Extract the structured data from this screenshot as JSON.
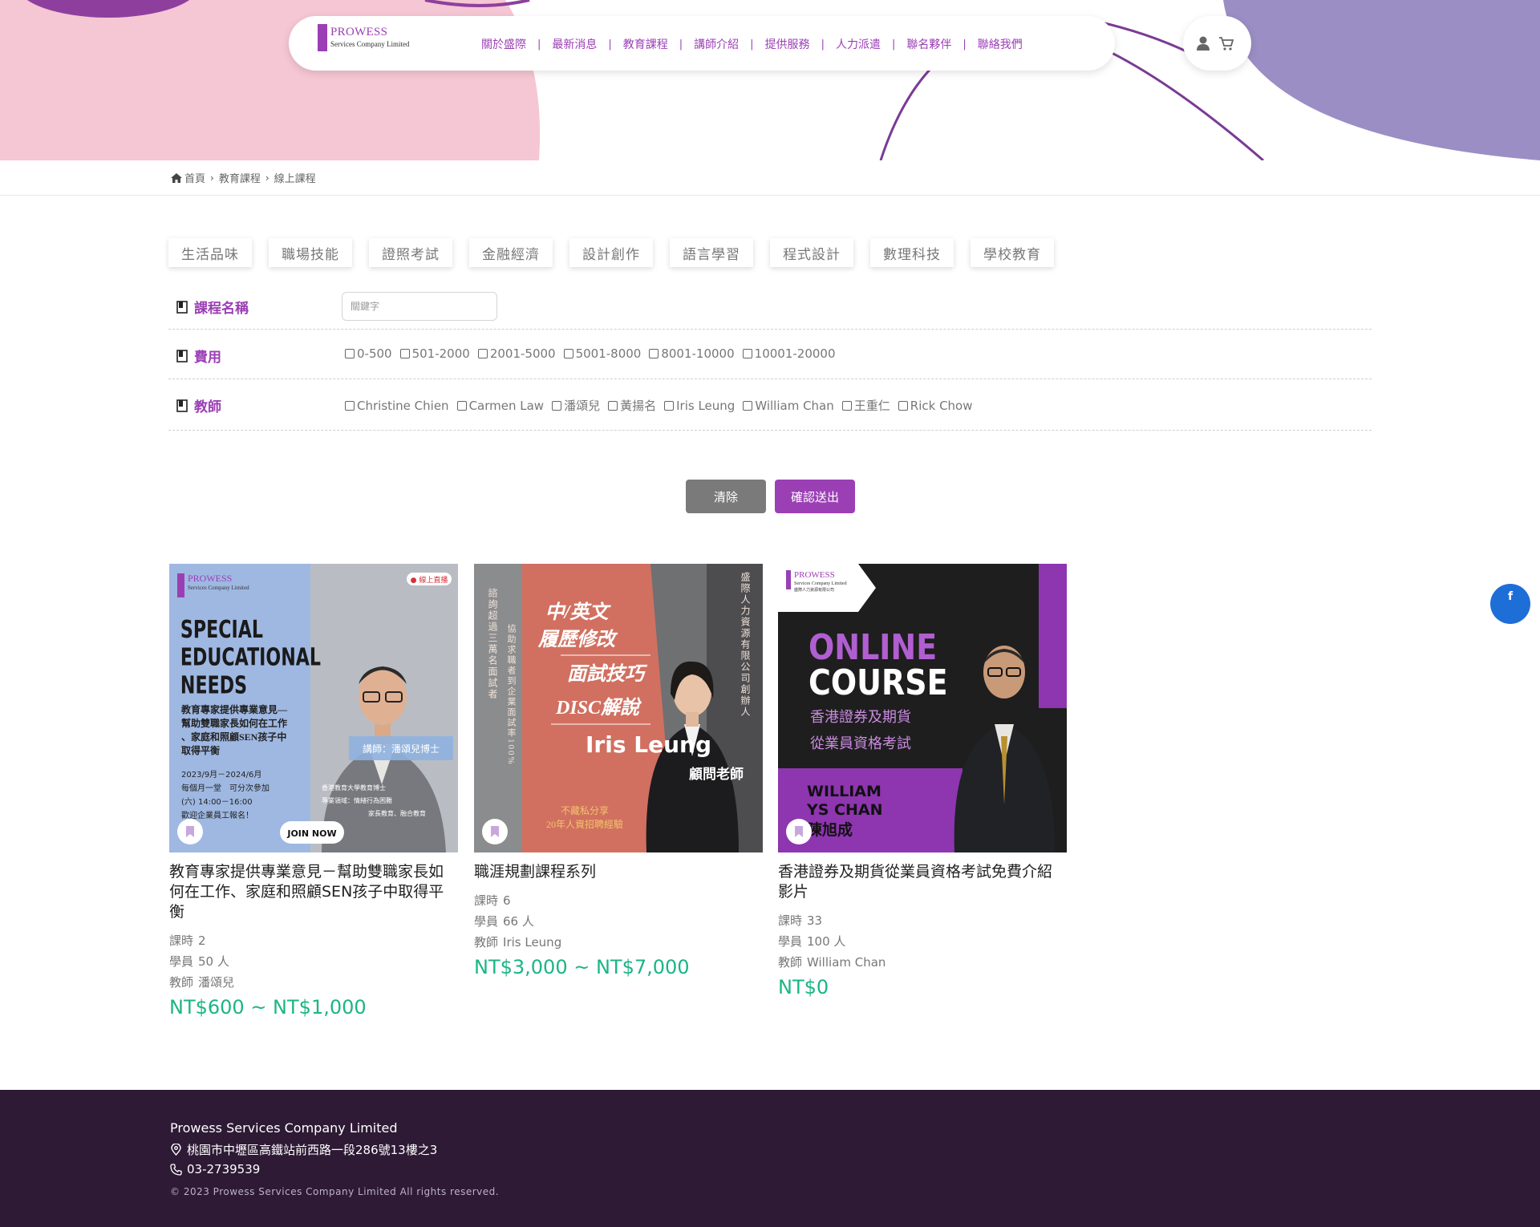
{
  "colors": {
    "accent": "#9b3fb5",
    "price": "#1bb585",
    "footer_bg": "#2e1a35",
    "pink": "#f5c6d3",
    "lavender": "#9b8ec4"
  },
  "brand": {
    "name": "PROWESS",
    "subtitle": "Services Company Limited"
  },
  "nav": {
    "items": [
      "關於盛際",
      "最新消息",
      "教育課程",
      "講師介紹",
      "提供服務",
      "人力派遣",
      "聯名夥伴",
      "聯絡我們"
    ]
  },
  "header_icons": [
    "user-icon",
    "cart-icon"
  ],
  "breadcrumb": {
    "home": "首頁",
    "level1": "教育課程",
    "level2": "線上課程"
  },
  "categories": [
    "生活品味",
    "職場技能",
    "證照考試",
    "金融經濟",
    "設計創作",
    "語言學習",
    "程式設計",
    "數理科技",
    "學校教育"
  ],
  "filters": {
    "course_name": {
      "label": "課程名稱",
      "placeholder": "關鍵字"
    },
    "fee": {
      "label": "費用",
      "options": [
        "0-500",
        "501-2000",
        "2001-5000",
        "5001-8000",
        "8001-10000",
        "10001-20000"
      ]
    },
    "teacher": {
      "label": "教師",
      "options": [
        "Christine Chien",
        "Carmen Law",
        "潘頌兒",
        "黃揚名",
        "Iris Leung",
        "William Chan",
        "王重仁",
        "Rick Chow"
      ]
    }
  },
  "buttons": {
    "clear": "清除",
    "submit": "確認送出"
  },
  "courses": [
    {
      "title": "教育專家提供專業意見－幫助雙職家長如何在工作、家庭和照顧SEN孩子中取得平衡",
      "hours_label": "課時",
      "hours": "2",
      "students_label": "學員",
      "students": "50 人",
      "teacher_label": "教師",
      "teacher": "潘頌兒",
      "price": "NT$600 ~ NT$1,000",
      "image": {
        "brand": "PROWESS",
        "brand_sub": "Services Company Limited",
        "badge": "● 線上直播",
        "headline": [
          "SPECIAL",
          "EDUCATIONAL",
          "NEEDS"
        ],
        "desc": [
          "教育專家提供專業意見—",
          "幫助雙職家長如何在工作",
          "、家庭和照顧SEN孩子中",
          "取得平衡"
        ],
        "dates": [
          "2023/9月－2024/6月",
          "每個月一堂　可分次參加",
          "(六) 14:00－16:00",
          "歡迎企業員工報名！"
        ],
        "lecturer": "講師：潘頌兒博士",
        "bio": [
          "香港教育大學教育博士",
          "專業領域：情緒行為困難",
          "家長教育、融合教育"
        ],
        "cta": "JOIN NOW"
      }
    },
    {
      "title": "職涯規劃課程系列",
      "hours_label": "課時",
      "hours": "6",
      "students_label": "學員",
      "students": "66 人",
      "teacher_label": "教師",
      "teacher": "Iris Leung",
      "price": "NT$3,000 ~ NT$7,000",
      "image": {
        "left_vertical_1": "諮詢超過三萬名面試者",
        "left_vertical_2": "協助求職者到企業面試率100%",
        "right_vertical": "盛際人力資源有限公司創辦人",
        "lines": [
          "中/英文",
          "履歷修改",
          "面試技巧",
          "DISC解說"
        ],
        "name": "Iris Leung",
        "role": "顧問老師",
        "footer": [
          "不藏私分享",
          "20年人資招聘經驗"
        ]
      }
    },
    {
      "title": "香港證券及期貨從業員資格考試免費介紹影片",
      "hours_label": "課時",
      "hours": "33",
      "students_label": "學員",
      "students": "100 人",
      "teacher_label": "教師",
      "teacher": "William Chan",
      "price": "NT$0",
      "image": {
        "brand": "PROWESS",
        "brand_sub": "Services Company Limited",
        "brand_sub2": "盛際人力資源有限公司",
        "headline": [
          "ONLINE",
          "COURSE"
        ],
        "subtitle": [
          "香港證券及期貨",
          "從業員資格考試"
        ],
        "name": [
          "WILLIAM",
          "YS CHAN",
          "陳旭成"
        ]
      }
    }
  ],
  "footer": {
    "company": "Prowess Services Company Limited",
    "address": "桃園市中壢區高鐵站前西路一段286號13樓之3",
    "phone": "03-2739539",
    "copyright": "© 2023 Prowess Services Company Limited All rights reserved."
  }
}
